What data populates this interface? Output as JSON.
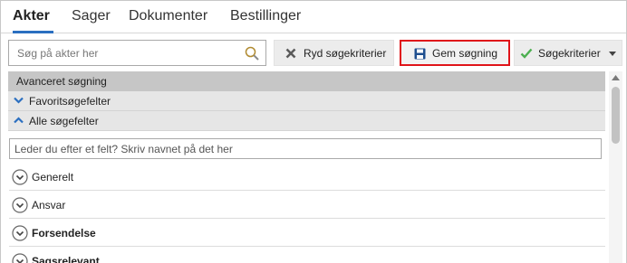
{
  "tabs": [
    {
      "label": "Akter",
      "active": true
    },
    {
      "label": "Sager",
      "active": false
    },
    {
      "label": "Dokumenter",
      "active": false
    },
    {
      "label": "Bestillinger",
      "active": false
    }
  ],
  "toolbar": {
    "search_placeholder": "Søg på akter her",
    "clear_label": "Ryd søgekriterier",
    "save_label": "Gem søgning",
    "criteria_label": "Søgekriterier"
  },
  "panel": {
    "advanced_label": "Avanceret søgning",
    "favorites_label": "Favoritsøgefelter",
    "all_fields_label": "Alle søgefelter",
    "field_search_placeholder": "Leder du efter et felt? Skriv navnet på det her",
    "groups": [
      {
        "label": "Generelt",
        "bold": false
      },
      {
        "label": "Ansvar",
        "bold": false
      },
      {
        "label": "Forsendelse",
        "bold": true
      },
      {
        "label": "Sagsrelevant",
        "bold": true
      }
    ]
  },
  "colors": {
    "accent": "#2b6fc0",
    "highlight_border": "#e0141a",
    "save_icon": "#1f4f8f",
    "clear_icon": "#5a5a5a",
    "check_icon": "#4caf50"
  },
  "icons": [
    "search-icon",
    "close-x-icon",
    "floppy-disk-icon",
    "checkmark-icon",
    "caret-down-icon",
    "chevron-down-icon",
    "chevron-up-icon",
    "circle-chevron-down-icon"
  ]
}
